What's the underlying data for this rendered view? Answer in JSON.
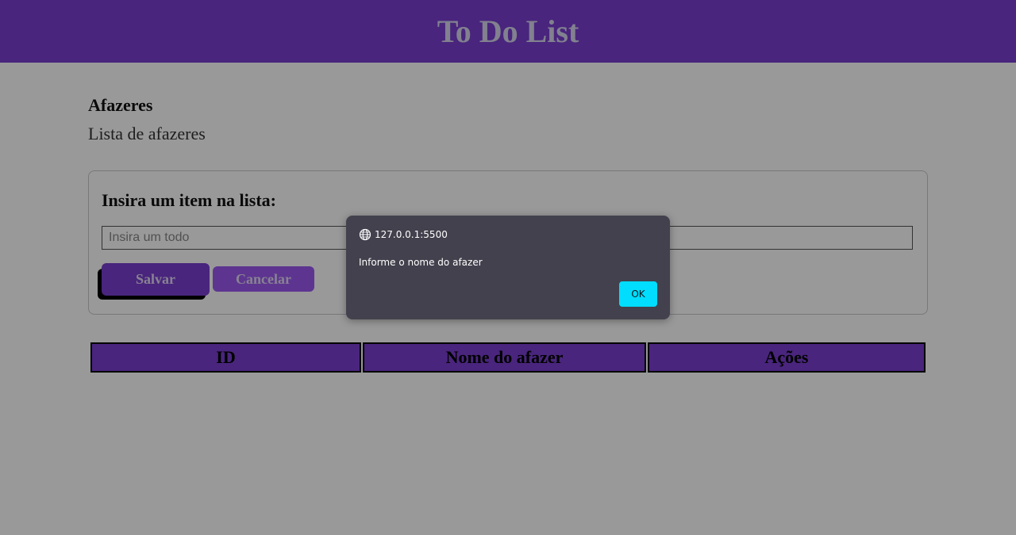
{
  "app": {
    "title": "To Do List"
  },
  "section": {
    "title": "Afazeres",
    "subtitle": "Lista de afazeres"
  },
  "form": {
    "label": "Insira um item na lista:",
    "input_placeholder": "Insira um todo",
    "input_value": "",
    "save_label": "Salvar",
    "cancel_label": "Cancelar"
  },
  "table": {
    "headers": [
      "ID",
      "Nome do afazer",
      "Ações"
    ],
    "rows": []
  },
  "alert": {
    "origin": "127.0.0.1:5500",
    "origin_icon": "globe-icon",
    "message": "Informe o nome do afazer",
    "ok_label": "OK"
  },
  "colors": {
    "header_purple": "#7b3fd1",
    "button_purple": "#9b59f0",
    "dialog_bg": "#42414d",
    "ok_button": "#00ddff"
  }
}
